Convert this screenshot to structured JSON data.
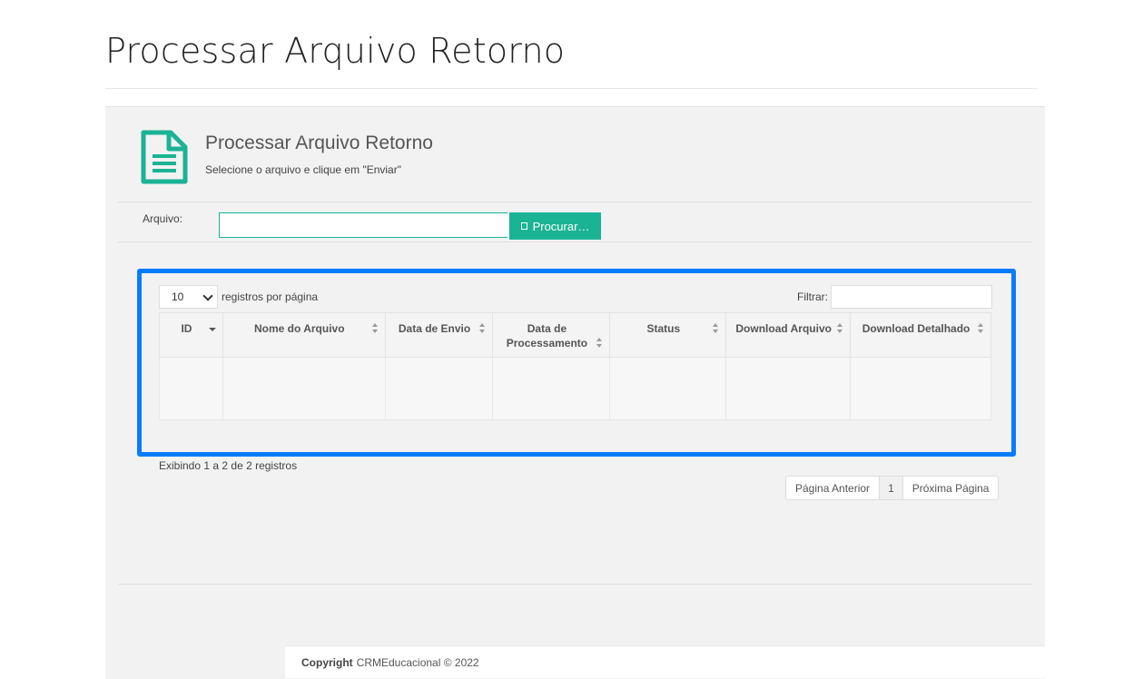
{
  "page": {
    "title": "Processar Arquivo Retorno"
  },
  "panel": {
    "heading": "Processar Arquivo Retorno",
    "subtitle": "Selecione o arquivo e clique em \"Enviar\"",
    "icon": "document-icon",
    "accent_color": "#1ab394"
  },
  "upload": {
    "label": "Arquivo:",
    "value": "",
    "browse_label": "Procurar…",
    "browse_icon": "folder-icon"
  },
  "table_controls": {
    "page_length": "10",
    "page_length_label": "registros por página",
    "filter_label": "Filtrar:",
    "filter_value": ""
  },
  "table": {
    "columns": [
      "ID",
      "Nome do Arquivo",
      "Data de Envio",
      "Data de Processamento",
      "Status",
      "Download Arquivo",
      "Download Detalhado"
    ],
    "sort": {
      "column": "ID",
      "direction": "desc"
    },
    "rows": []
  },
  "info": "Exibindo 1 a 2 de 2 registros",
  "pagination": {
    "prev": "Página Anterior",
    "current": "1",
    "next": "Próxima Página"
  },
  "highlight_color": "#0a7bff",
  "footer": {
    "label": "Copyright",
    "text": "CRMEducacional © 2022"
  }
}
